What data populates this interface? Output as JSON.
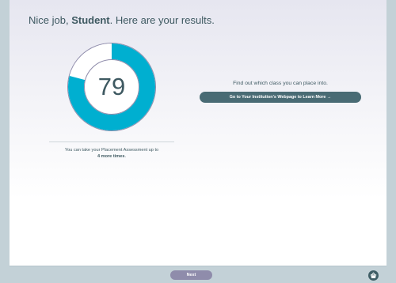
{
  "header": {
    "greeting": "Nice job,",
    "user_name": "Student",
    "results_text": ". Here are your results."
  },
  "score": {
    "value": "79",
    "percent": 79,
    "fill_color": "#00afd0",
    "track_color": "#ffffff",
    "ring_border_color": "#8f8cab"
  },
  "attempts": {
    "prefix": "You can take your Placement Assessment up to",
    "count": "4 more times",
    "suffix": "."
  },
  "placement": {
    "prompt": "Find out which class you can place into.",
    "button_label": "Go to Your Institution's Webpage to Learn More →"
  },
  "footer": {
    "next_label": "Next",
    "basket_icon": "basket-icon"
  }
}
